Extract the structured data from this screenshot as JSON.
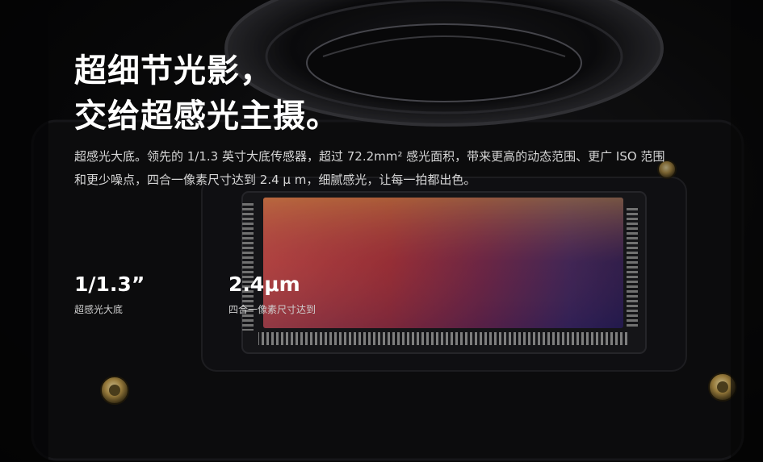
{
  "headline": {
    "line1": "超细节光影，",
    "line2": "交给超感光主摄。"
  },
  "description": "超感光大底。领先的 1/1.3 英寸大底传感器，超过 72.2mm² 感光面积，带来更高的动态范围、更广 ISO 范围和更少噪点，四合一像素尺寸达到 2.4 μ m，细腻感光，让每一拍都出色。",
  "stats": [
    {
      "value": "1/1.3”",
      "label": "超感光大底"
    },
    {
      "value": "2.4μm",
      "label": "四合一像素尺寸达到"
    }
  ]
}
